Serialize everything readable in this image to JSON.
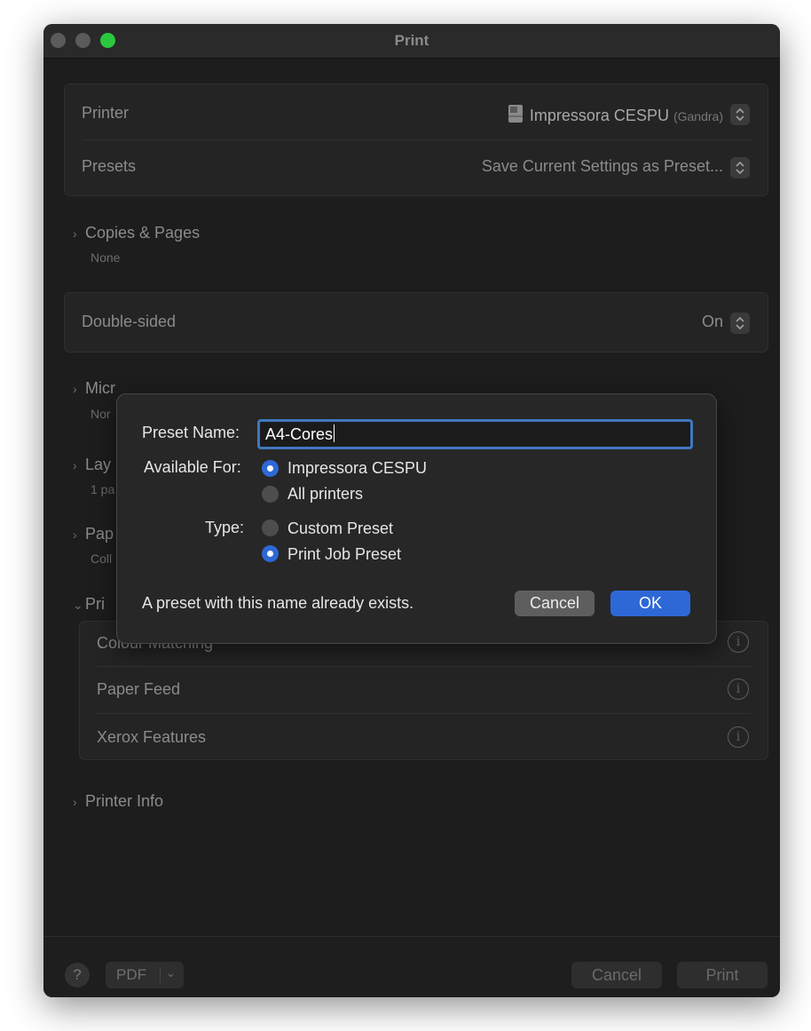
{
  "window": {
    "title": "Print"
  },
  "printer_group": {
    "printer_label": "Printer",
    "printer_name": "Impressora CESPU",
    "printer_location": "(Gandra)",
    "presets_label": "Presets",
    "presets_value": "Save Current Settings as Preset..."
  },
  "copies_pages": {
    "title": "Copies & Pages",
    "subtitle": "None"
  },
  "double_sided": {
    "label": "Double-sided",
    "value": "On"
  },
  "hidden_sections": [
    {
      "title": "Micr",
      "subtitle": "Nor"
    },
    {
      "title": "Lay",
      "subtitle": "1 pa"
    },
    {
      "title": "Pap",
      "subtitle": "Coll"
    },
    {
      "title": "Pri",
      "subtitle": ""
    }
  ],
  "printer_features": {
    "items": [
      "Colour Matching",
      "Paper Feed",
      "Xerox Features"
    ]
  },
  "printer_info": {
    "title": "Printer Info"
  },
  "bottom_bar": {
    "help": "?",
    "pdf": "PDF",
    "cancel": "Cancel",
    "print": "Print"
  },
  "preset_sheet": {
    "name_label": "Preset Name:",
    "name_value": "A4-Cores",
    "available_label": "Available For:",
    "available_options": [
      "Impressora CESPU",
      "All printers"
    ],
    "available_selected": "Impressora CESPU",
    "type_label": "Type:",
    "type_options": [
      "Custom Preset",
      "Print Job Preset"
    ],
    "type_selected": "Print Job Preset",
    "message": "A preset with this name already exists.",
    "cancel": "Cancel",
    "ok": "OK"
  },
  "colors": {
    "accent": "#2e68d6",
    "traffic_zoom": "#2ac840"
  }
}
